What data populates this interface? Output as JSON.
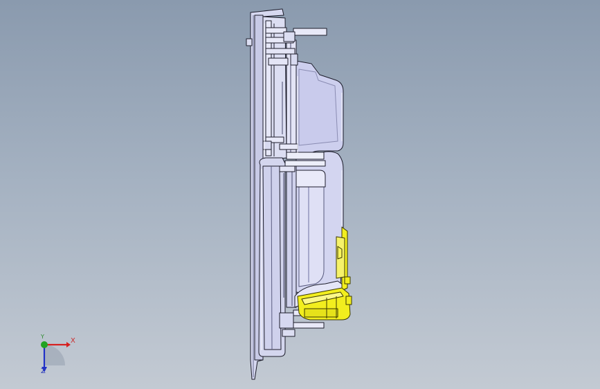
{
  "viewport": {
    "background_top": "#8a9aae",
    "background_bottom": "#c3cad3"
  },
  "model": {
    "body_color": "#d6d8f0",
    "edge_color": "#1c1c2a",
    "highlight_color": "#ecedfa",
    "connector_color": "#f2ee1e",
    "connector_edge": "#3a3800"
  },
  "triad": {
    "x_label": "X",
    "y_label": "Y",
    "z_label": "Z",
    "x_color": "#d62020",
    "y_color": "#22a322",
    "z_color": "#2030c8"
  }
}
